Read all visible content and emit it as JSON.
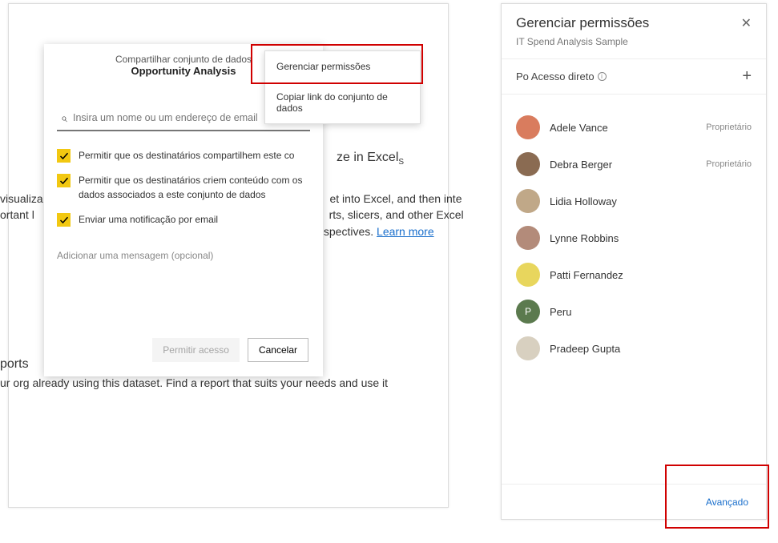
{
  "share_dialog": {
    "header": "Compartilhar conjunto de dados",
    "subtitle": "Opportunity Analysis",
    "more_button": "...",
    "menu": {
      "manage": "Gerenciar permissões",
      "copy_link": "Copiar link do conjunto de dados"
    },
    "search_placeholder": "Insira um nome ou um endereço de email",
    "checkbox1": "Permitir que os destinatários compartilhem este co",
    "checkbox2": "Permitir que os destinatários criem conteúdo com os dados associados a este conjunto de dados",
    "checkbox3": "Enviar uma notificação por email",
    "message_placeholder": "Adicionar uma mensagem (opcional)",
    "grant_label": "Permitir acesso",
    "cancel_label": "Cancelar"
  },
  "background": {
    "title_fragment": "ze in Excel",
    "p1a": "visualiza",
    "p1b": "et into Excel, and then inte",
    "p2a": "ortant l",
    "p2b": "rts, slicers, and other Excel",
    "p3": "spectives. ",
    "learn_more": "Learn more",
    "h2": "ports",
    "p4": "ur org already using this dataset. Find a report that suits your needs and use it"
  },
  "right_panel": {
    "title": "Gerenciar permissões",
    "subtitle": "IT Spend Analysis Sample",
    "tab_label": "Po Acesso direto",
    "owner_role": "Proprietário",
    "advanced": "Avançado",
    "users": [
      {
        "name": "Adele Vance",
        "role": "Proprietário",
        "bg": "#d97c5e"
      },
      {
        "name": "Debra Berger",
        "role": "Proprietário",
        "bg": "#8a6b52"
      },
      {
        "name": "Lidia Holloway",
        "role": "",
        "bg": "#c0a888"
      },
      {
        "name": "Lynne Robbins",
        "role": "",
        "bg": "#b38b7a"
      },
      {
        "name": "Patti Fernandez",
        "role": "",
        "bg": "#e8d65d"
      },
      {
        "name": "Peru",
        "role": "",
        "bg": "#5b7a4e",
        "initial": "P"
      },
      {
        "name": "Pradeep Gupta",
        "role": "",
        "bg": "#d8d0c0"
      }
    ]
  }
}
